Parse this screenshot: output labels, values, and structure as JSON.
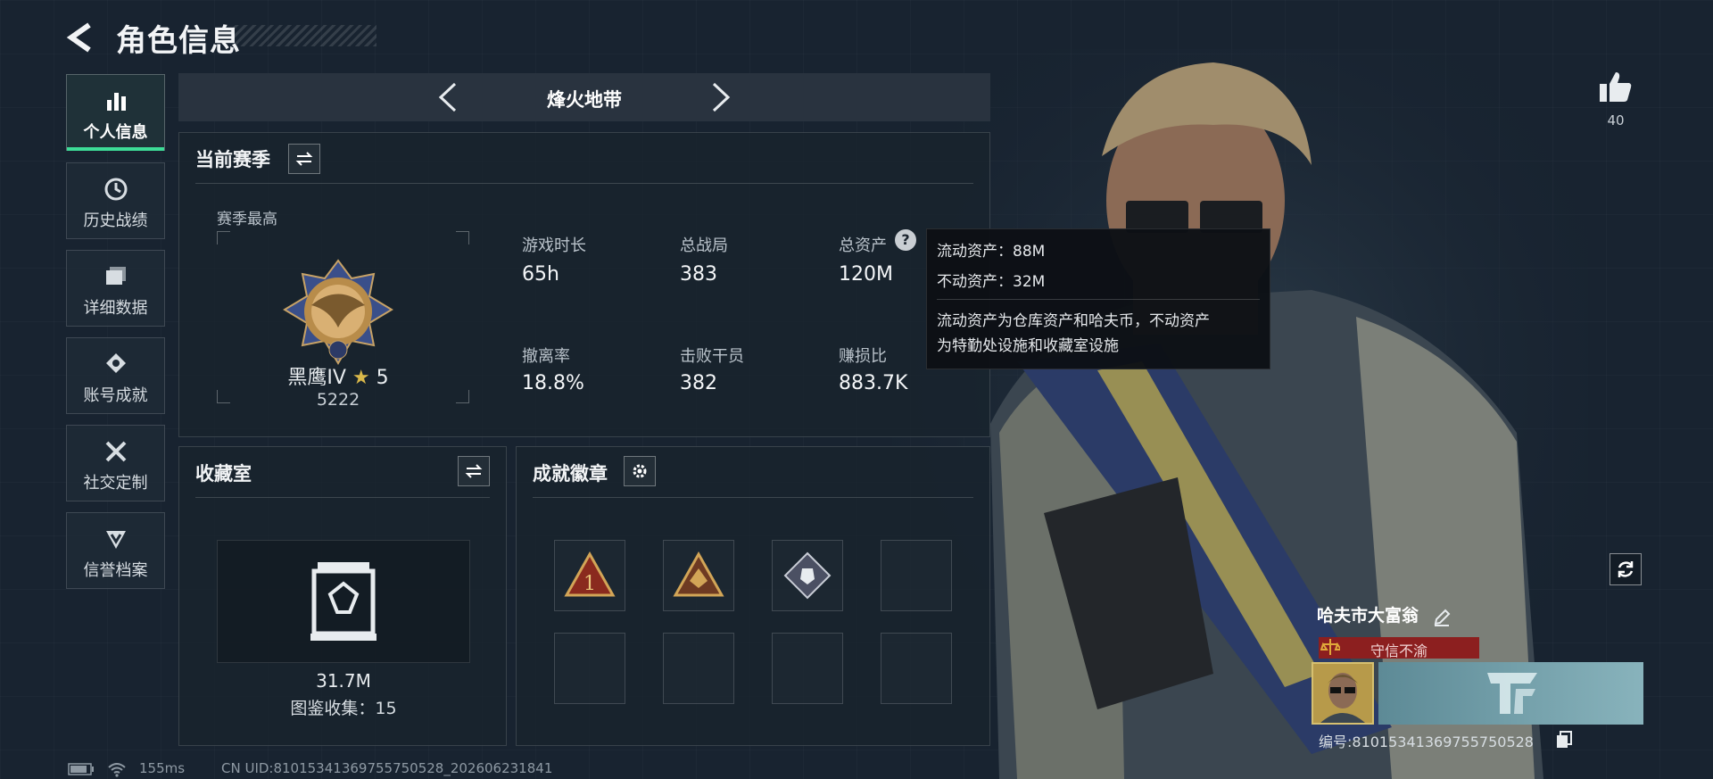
{
  "header": {
    "title": "角色信息"
  },
  "sidebar": {
    "items": [
      {
        "label": "个人信息",
        "icon": "bar-chart-icon"
      },
      {
        "label": "历史战绩",
        "icon": "history-clock-icon"
      },
      {
        "label": "详细数据",
        "icon": "folder-data-icon"
      },
      {
        "label": "账号成就",
        "icon": "achievement-medal-icon"
      },
      {
        "label": "社交定制",
        "icon": "tools-customize-icon"
      },
      {
        "label": "信誉档案",
        "icon": "credit-badge-icon"
      }
    ]
  },
  "mode": {
    "name": "烽火地带"
  },
  "season": {
    "title": "当前赛季",
    "best_label": "赛季最高",
    "rank_name": "黑鹰IV",
    "rank_stars": "5",
    "rank_score": "5222",
    "stats": [
      {
        "label": "游戏时长",
        "value": "65h"
      },
      {
        "label": "总战局",
        "value": "383"
      },
      {
        "label": "总资产",
        "value": "120M"
      },
      {
        "label": "撤离率",
        "value": "18.8%"
      },
      {
        "label": "击败干员",
        "value": "382"
      },
      {
        "label": "赚损比",
        "value": "883.7K"
      }
    ]
  },
  "tooltip": {
    "liquid": "流动资产：88M",
    "fixed": "不动资产：32M",
    "desc_line1": "流动资产为仓库资产和哈夫币，不动资产",
    "desc_line2": "为特勤处设施和收藏室设施"
  },
  "collection": {
    "title": "收藏室",
    "value": "31.7M",
    "catalog": "图鉴收集：15"
  },
  "badges": {
    "title": "成就徽章"
  },
  "likes": {
    "count": "40"
  },
  "profile": {
    "name": "哈夫市大富翁",
    "tag": "守信不渝",
    "id_label": "编号:810153413697557505​28"
  },
  "statusbar": {
    "ping": "155ms",
    "uid": "CN UID:810153413697557505​28_202606231841"
  },
  "colors": {
    "accent": "#3ddc97",
    "tag_red": "#8c1f1f",
    "tooltip_bg": "#0c1015"
  }
}
